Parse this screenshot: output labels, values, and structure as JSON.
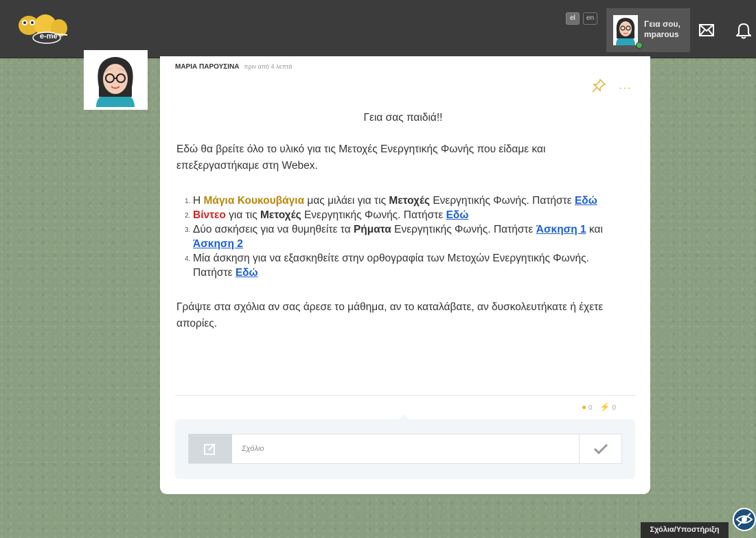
{
  "header": {
    "logo_text": "e-me",
    "languages": [
      {
        "code": "el",
        "active": true
      },
      {
        "code": "en",
        "active": false
      }
    ],
    "user": {
      "greeting_line1": "Γεια σου,",
      "greeting_line2": "mparous",
      "status": "online"
    },
    "icons": {
      "messages": "envelope-icon",
      "notifications": "bell-icon"
    }
  },
  "post": {
    "author": "ΜΑΡΙΑ ΠΑΡΟΥΣΙΝΑ",
    "time": "πριν από 4 λεπτά",
    "greeting": "Γεια σας παιδιά!!",
    "intro": "Εδώ θα βρείτε όλο το υλικό για τις Μετοχές Ενεργητικής Φωνής που είδαμε και επεξεργαστήκαμε στη Webex.",
    "items": {
      "i1": {
        "num": "1.",
        "a": "Η ",
        "highlight": "Μάγια Κουκουβάγια",
        "b": " μας μιλάει για τις ",
        "bold": "Μετοχές",
        "c": " Ενεργητικής Φωνής. Πατήστε ",
        "link": "Εδώ"
      },
      "i2": {
        "num": "2.",
        "highlight": "Βίντεο",
        "a": " για τις ",
        "bold": "Μετοχές",
        "b": " Ενεργητικής Φωνής. Πατήστε ",
        "link": "Εδώ"
      },
      "i3": {
        "num": "3.",
        "a": "Δύο ασκήσεις για να θυμηθείτε τα ",
        "bold": "Ρήματα",
        "b": " Ενεργητικής Φωνής. Πατήστε ",
        "link1": "Άσκηση 1",
        "c": " και ",
        "link2": "Άσκηση 2"
      },
      "i4": {
        "num": "4.",
        "a": "Μία άσκηση για να εξασκηθείτε στην ορθογραφία των Μετοχών Ενεργητικής Φωνής. Πατήστε ",
        "link": "Εδώ"
      }
    },
    "closing": "Γράψτε στα σχόλια αν σας άρεσε το μάθημα, αν το καταλάβατε, αν δυσκολευτήκατε ή έχετε απορίες.",
    "comments_count": "0",
    "likes_count": "0"
  },
  "comment": {
    "placeholder": "Σχόλιο",
    "value": ""
  },
  "footer": {
    "support_label": "Σχόλια/Υποστήριξη"
  },
  "colors": {
    "topbar": "#3c3c3c",
    "highlight_gold": "#b8860b",
    "highlight_red": "#d42020",
    "link": "#1a5fd0",
    "accent_yellow": "#e8b830"
  }
}
